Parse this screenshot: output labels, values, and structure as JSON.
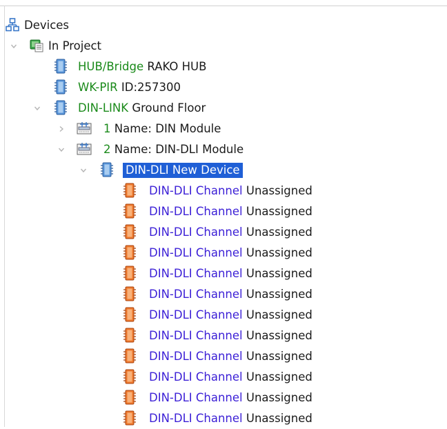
{
  "tree": {
    "root": {
      "label": "Devices",
      "icon": "hierarchy-icon"
    },
    "project": {
      "label": "In Project",
      "icon": "project-icon"
    },
    "hub": {
      "type": "HUB/Bridge",
      "name": "RAKO HUB",
      "icon": "device-blue-icon"
    },
    "pir": {
      "type": "WK-PIR",
      "name": "ID:257300",
      "icon": "device-blue-icon"
    },
    "dinlink": {
      "type": "DIN-LINK",
      "name": "Ground Floor",
      "icon": "device-blue-icon"
    },
    "module1": {
      "number": "1",
      "name": "Name: DIN Module",
      "icon": "din-module-icon"
    },
    "module2": {
      "number": "2",
      "name": "Name: DIN-DLI Module",
      "icon": "din-module-icon"
    },
    "newdevice": {
      "label": "DIN-DLI New Device",
      "icon": "device-blue-icon"
    },
    "channels": [
      {
        "type": "DIN-DLI Channel",
        "name": "Unassigned"
      },
      {
        "type": "DIN-DLI Channel",
        "name": "Unassigned"
      },
      {
        "type": "DIN-DLI Channel",
        "name": "Unassigned"
      },
      {
        "type": "DIN-DLI Channel",
        "name": "Unassigned"
      },
      {
        "type": "DIN-DLI Channel",
        "name": "Unassigned"
      },
      {
        "type": "DIN-DLI Channel",
        "name": "Unassigned"
      },
      {
        "type": "DIN-DLI Channel",
        "name": "Unassigned"
      },
      {
        "type": "DIN-DLI Channel",
        "name": "Unassigned"
      },
      {
        "type": "DIN-DLI Channel",
        "name": "Unassigned"
      },
      {
        "type": "DIN-DLI Channel",
        "name": "Unassigned"
      },
      {
        "type": "DIN-DLI Channel",
        "name": "Unassigned"
      },
      {
        "type": "DIN-DLI Channel",
        "name": "Unassigned"
      }
    ]
  },
  "colors": {
    "type_green": "#1a8a1a",
    "type_purple": "#3b1fd6",
    "selection": "#1f5fd6",
    "device_blue": "#3a78c9",
    "channel_orange": "#e0641e"
  }
}
